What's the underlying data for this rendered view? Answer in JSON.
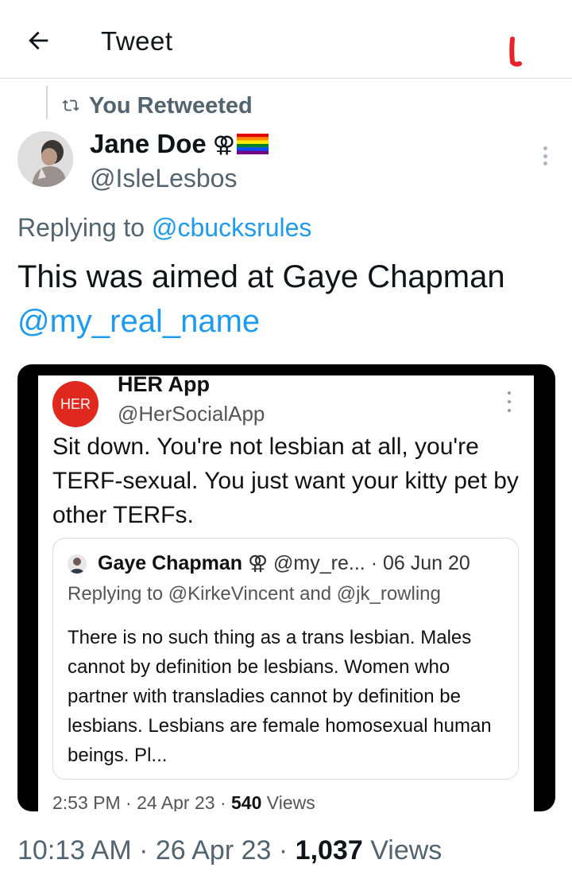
{
  "header": {
    "title": "Tweet",
    "back_icon": "arrow-left-icon"
  },
  "retweet": {
    "label": "You Retweeted",
    "icon": "retweet-icon"
  },
  "author": {
    "name": "Jane Doe",
    "symbol": "⚢",
    "flag": "rainbow-flag",
    "handle": "@IsleLesbos"
  },
  "reply": {
    "prefix": "Replying to",
    "handle": "@cbucksrules"
  },
  "tweet": {
    "text": "This was aimed at Gaye Chapman",
    "mention": "@my_real_name"
  },
  "embedded": {
    "author_avatar_text": "HER",
    "author_name": "HER App",
    "author_handle": "@HerSocialApp",
    "text": "Sit down. You're not lesbian at all, you're TERF-sexual.  You just want your kitty pet by other TERFs.",
    "quote": {
      "name": "Gaye Chapman",
      "symbol": "⚢",
      "handle": "@my_re...",
      "date": "· 06 Jun 20",
      "reply_line": "Replying to @KirkeVincent and @jk_rowling",
      "text": "There is no such thing as a trans lesbian. Males cannot by definition be lesbians. Women who partner with transladies cannot by definition be lesbians. Lesbians are female homosexual human beings. Pl..."
    },
    "footer": {
      "time": "2:53 PM · 24 Apr 23 · ",
      "views": "540",
      "views_label": " Views"
    }
  },
  "meta": {
    "time": "10:13 AM · 26 Apr 23 · ",
    "views": "1,037",
    "views_label": " Views"
  },
  "colors": {
    "link": "#1d9bf0",
    "muted": "#536471",
    "her_red": "#e0281e",
    "mark_red": "#e8232a"
  }
}
